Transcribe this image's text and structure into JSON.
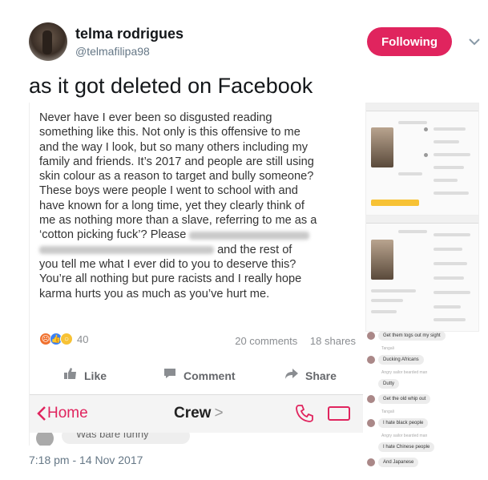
{
  "user": {
    "name": "telma rodrigues",
    "handle": "@telmafilipa98",
    "follow_label": "Following"
  },
  "tweet": {
    "text": "as it got deleted on Facebook",
    "timestamp": "7:18 pm - 14 Nov 2017"
  },
  "post": {
    "line1": "Never have I ever been so disgusted reading",
    "line2": "something like this. Not only is this offensive to me",
    "line3": "and the way I look, but so many others including my",
    "line4": "family and friends. It’s 2017 and people are still using",
    "line5": "skin colour as a reason to target and bully someone?",
    "line6": "These boys were people I went to school with and",
    "line7": "have known for a long time, yet they clearly think of",
    "line8": "me as nothing more than a slave, referring to me as a",
    "line9": "‘cotton picking fuck’? Please",
    "line10": "and the rest of",
    "line11": "you tell me what I ever did to you to deserve this?",
    "line12": "You’re all nothing but pure racists and I really hope",
    "line13": "karma hurts you as much as you’ve hurt me.",
    "reaction_count": "40",
    "comments": "20 comments",
    "shares": "18 shares",
    "like_label": "Like",
    "comment_label": "Comment",
    "share_label": "Share"
  },
  "messenger": {
    "back_label": "Home",
    "title": "Crew",
    "chev": ">",
    "peek_text": "Was bare funny"
  },
  "chat_messages": [
    {
      "text": "Get them togs out my sight"
    },
    {
      "meta": "Tangali"
    },
    {
      "text": "Ducking Africans"
    },
    {
      "meta": "Angry sailor bearded man"
    },
    {
      "text": "Dutty"
    },
    {
      "text": "Get the old whip out"
    },
    {
      "meta": "Tangali"
    },
    {
      "text": "I hate black people"
    },
    {
      "meta": "Angry sailor bearded man"
    },
    {
      "text": "I hate Chinese people"
    },
    {
      "text": "And Japanese"
    }
  ],
  "colors": {
    "follow": "#e0245e",
    "messenger_accent": "#e0245e"
  }
}
